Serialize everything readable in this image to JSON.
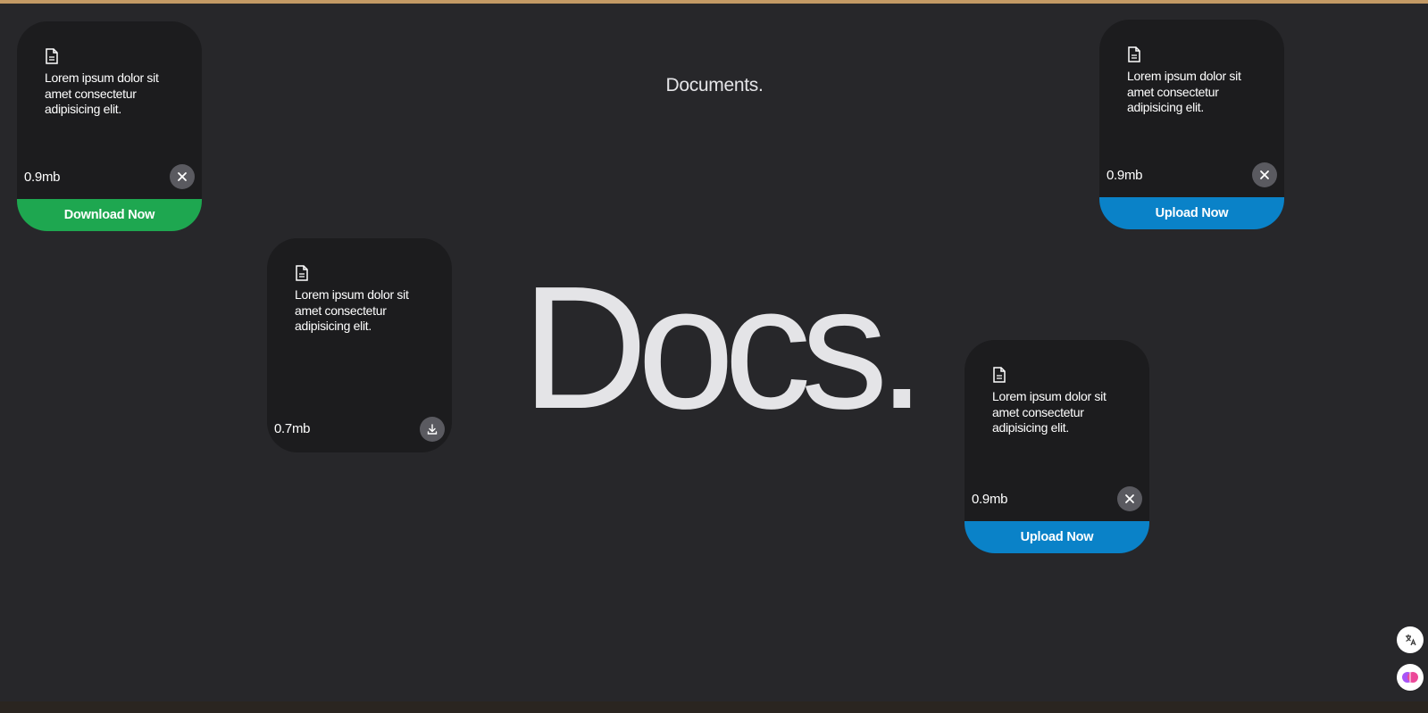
{
  "page": {
    "heading": "Documents.",
    "hero": "Docs."
  },
  "cards": [
    {
      "description": "Lorem ipsum dolor sit amet consectetur adipisicing elit.",
      "size": "0.9mb",
      "button_icon": "close-icon",
      "action_label": "Download Now",
      "action_color": "#1ea750"
    },
    {
      "description": "Lorem ipsum dolor sit amet consectetur adipisicing elit.",
      "size": "0.7mb",
      "button_icon": "download-icon"
    },
    {
      "description": "Lorem ipsum dolor sit amet consectetur adipisicing elit.",
      "size": "0.9mb",
      "button_icon": "close-icon",
      "action_label": "Upload Now",
      "action_color": "#0a82c8"
    },
    {
      "description": "Lorem ipsum dolor sit amet consectetur adipisicing elit.",
      "size": "0.9mb",
      "button_icon": "close-icon",
      "action_label": "Upload Now",
      "action_color": "#0a82c8"
    }
  ],
  "colors": {
    "background": "#27272a",
    "card": "#1c1c1e",
    "accent_top": "#c49a65",
    "download_green": "#1ea750",
    "upload_blue": "#0a82c8"
  }
}
